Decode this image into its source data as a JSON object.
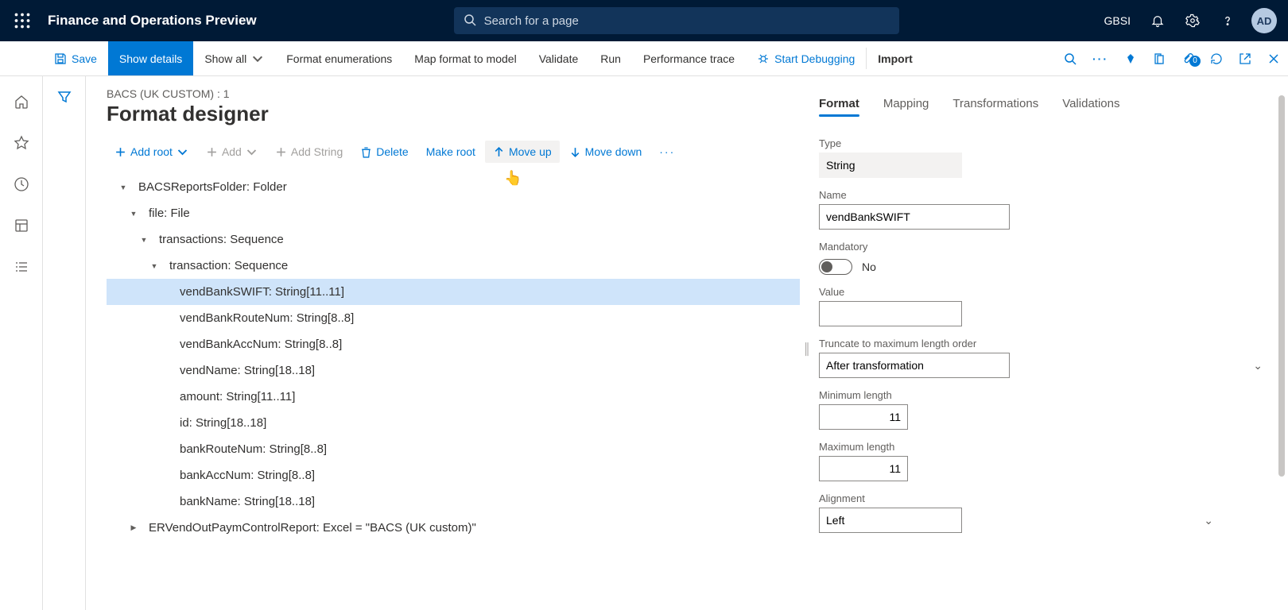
{
  "header": {
    "app_title": "Finance and Operations Preview",
    "search_placeholder": "Search for a page",
    "env": "GBSI",
    "avatar": "AD"
  },
  "cmdbar": {
    "save": "Save",
    "show_details": "Show details",
    "show_all": "Show all",
    "format_enum": "Format enumerations",
    "map": "Map format to model",
    "validate": "Validate",
    "run": "Run",
    "perf": "Performance trace",
    "debug": "Start Debugging",
    "import": "Import",
    "badge": "0"
  },
  "page": {
    "breadcrumb": "BACS (UK CUSTOM) : 1",
    "title": "Format designer"
  },
  "toolbar": {
    "add_root": "Add root",
    "add": "Add",
    "add_string": "Add String",
    "delete": "Delete",
    "make_root": "Make root",
    "move_up": "Move up",
    "move_down": "Move down"
  },
  "tree": [
    {
      "indent": 0,
      "caret": "▾",
      "label": "BACSReportsFolder: Folder"
    },
    {
      "indent": 1,
      "caret": "▾",
      "label": "file: File"
    },
    {
      "indent": 2,
      "caret": "▾",
      "label": "transactions: Sequence"
    },
    {
      "indent": 3,
      "caret": "▾",
      "label": "transaction: Sequence"
    },
    {
      "indent": 4,
      "caret": "",
      "label": "vendBankSWIFT: String[11..11]",
      "selected": true
    },
    {
      "indent": 4,
      "caret": "",
      "label": "vendBankRouteNum: String[8..8]"
    },
    {
      "indent": 4,
      "caret": "",
      "label": "vendBankAccNum: String[8..8]"
    },
    {
      "indent": 4,
      "caret": "",
      "label": "vendName: String[18..18]"
    },
    {
      "indent": 4,
      "caret": "",
      "label": "amount: String[11..11]"
    },
    {
      "indent": 4,
      "caret": "",
      "label": "id: String[18..18]"
    },
    {
      "indent": 4,
      "caret": "",
      "label": "bankRouteNum: String[8..8]"
    },
    {
      "indent": 4,
      "caret": "",
      "label": "bankAccNum: String[8..8]"
    },
    {
      "indent": 4,
      "caret": "",
      "label": "bankName: String[18..18]"
    },
    {
      "indent": 1,
      "caret": "▸",
      "label": "ERVendOutPaymControlReport: Excel = \"BACS (UK custom)\""
    }
  ],
  "tabs": {
    "format": "Format",
    "mapping": "Mapping",
    "transformations": "Transformations",
    "validations": "Validations"
  },
  "form": {
    "type_label": "Type",
    "type_value": "String",
    "name_label": "Name",
    "name_value": "vendBankSWIFT",
    "mandatory_label": "Mandatory",
    "mandatory_value": "No",
    "value_label": "Value",
    "value_value": "",
    "truncate_label": "Truncate to maximum length order",
    "truncate_value": "After transformation",
    "min_label": "Minimum length",
    "min_value": "11",
    "max_label": "Maximum length",
    "max_value": "11",
    "align_label": "Alignment",
    "align_value": "Left"
  }
}
